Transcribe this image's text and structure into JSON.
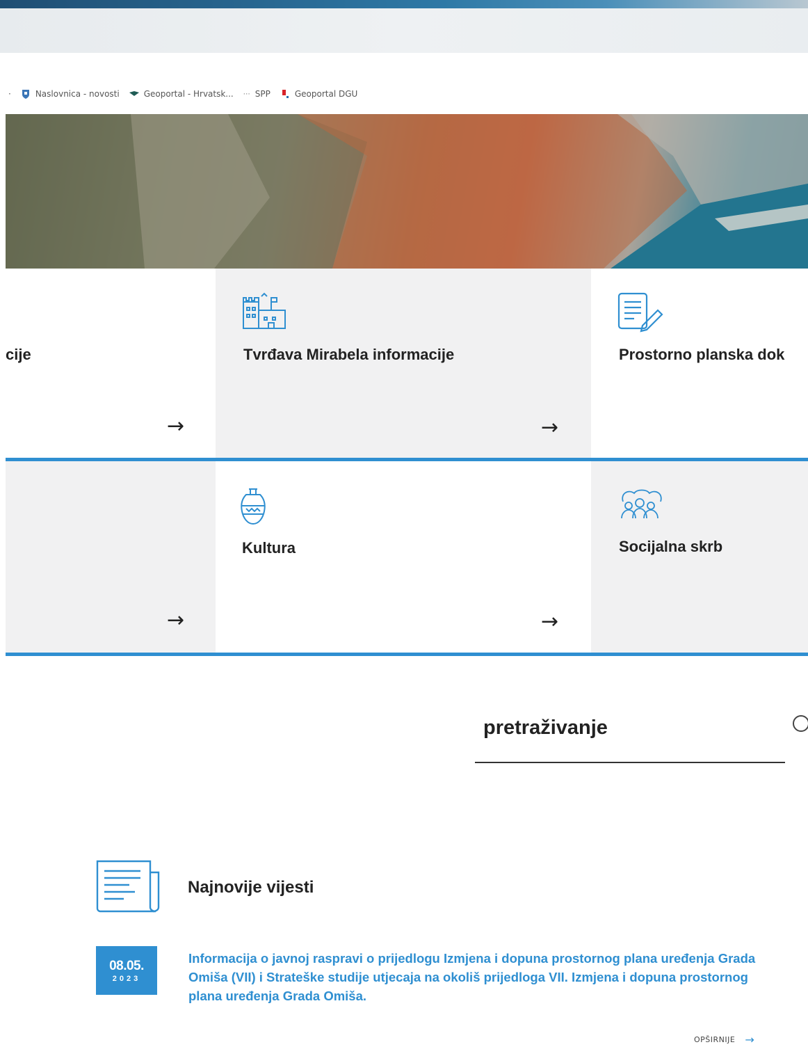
{
  "browser": {
    "bookmarks": [
      {
        "label": "Naslovnica - novosti",
        "icon": "shield-icon"
      },
      {
        "label": "Geoportal - Hrvatsk...",
        "icon": "map-flag-icon"
      },
      {
        "label": "SPP",
        "icon": "spp-icon"
      },
      {
        "label": "Geoportal DGU",
        "icon": "flag-icon"
      }
    ]
  },
  "cards": {
    "row1": [
      {
        "title": "cije"
      },
      {
        "title": "Tvrđava Mirabela informacije",
        "icon": "fortress-icon"
      },
      {
        "title": "Prostorno planska dok",
        "icon": "document-edit-icon"
      }
    ],
    "row2": [
      {
        "title": ""
      },
      {
        "title": "Kultura",
        "icon": "amphora-icon"
      },
      {
        "title": "Socijalna skrb",
        "icon": "community-icon"
      }
    ],
    "arrow": "→"
  },
  "search": {
    "label": "pretraživanje"
  },
  "news": {
    "heading": "Najnovije vijesti",
    "items": [
      {
        "day": "08.05.",
        "year": "2023",
        "text": "Informacija o javnoj raspravi o prijedlogu Izmjena i dopuna prostornog plana uređenja Grada Omiša (VII) i Strateške studije utjecaja na okoliš prijedloga VII. Izmjena i dopuna prostornog plana uređenja Grada Omiša."
      }
    ],
    "more_label": "OPŠIRNIJE",
    "more_arrow": "→"
  },
  "colors": {
    "accent": "#2f8fd1",
    "text": "#222222",
    "card_shade": "#f1f1f2"
  }
}
